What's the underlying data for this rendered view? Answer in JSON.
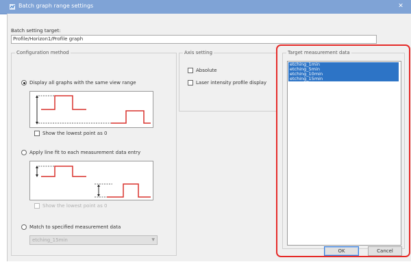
{
  "window": {
    "title": "Batch graph range settings",
    "close_glyph": "✕"
  },
  "batch_target": {
    "label": "Batch setting target:",
    "value": "Profile/Horizon1/Profile graph"
  },
  "configuration": {
    "title": "Configuration method",
    "option1": {
      "label": "Display all graphs with the same view range",
      "selected": true
    },
    "option1_check": {
      "label": "Show the lowest point as 0",
      "checked": false
    },
    "option2": {
      "label": "Apply line fit to each measurement data entry",
      "selected": false
    },
    "option2_check": {
      "label": "Show the lowest point as 0",
      "checked": false,
      "disabled": true
    },
    "option3": {
      "label": "Match to specified measurement data",
      "selected": false
    },
    "option3_combo": {
      "value": "etching_15min",
      "disabled": true
    }
  },
  "axis": {
    "title": "Axis setting",
    "absolute": {
      "label": "Absolute",
      "checked": false
    },
    "laser": {
      "label": "Laser intensity profile display",
      "checked": false
    }
  },
  "target_data": {
    "title": "Target measurement data",
    "items": [
      "etching_1min",
      "etching_5min",
      "etching_10min",
      "etching_15min"
    ]
  },
  "buttons": {
    "ok": "OK",
    "cancel": "Cancel"
  },
  "colors": {
    "highlight": "#e52a28",
    "selection": "#2d74c6",
    "illustration_line": "#d9302c"
  }
}
